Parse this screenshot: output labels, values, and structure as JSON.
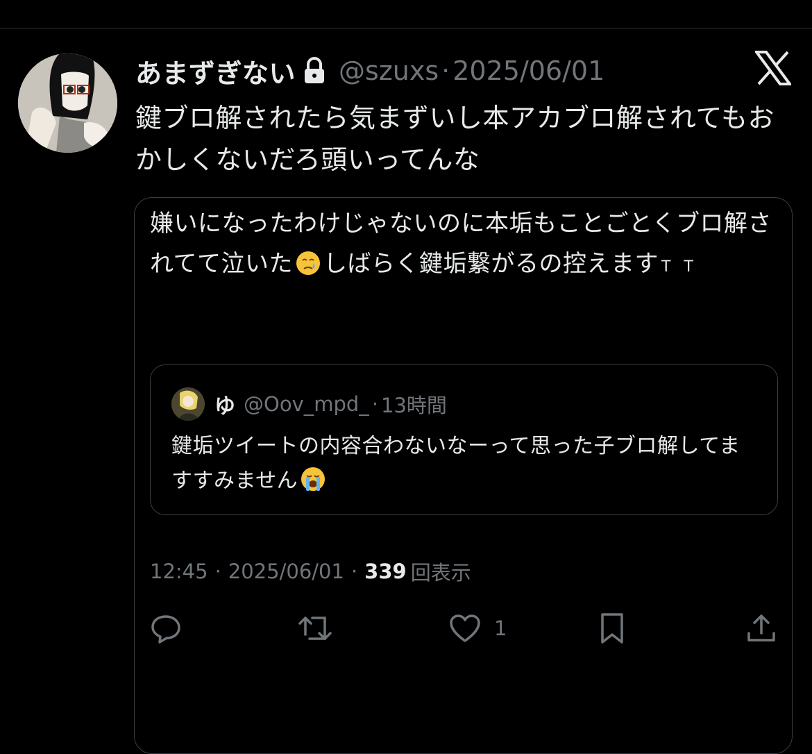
{
  "tweet": {
    "author_name": "あまずぎない",
    "author_handle": "@szuxs",
    "separator": "·",
    "date": "2025/06/01",
    "text": "鍵ブロ解されたら気まずいし本アカブロ解されてもおかしくないだろ頭いってんな"
  },
  "quote": {
    "text_part1": "嫌いになったわけじゃないのに本垢もことごとくブロ解されてて泣いた",
    "text_part2": "しばらく鍵垢繋がるの控えます",
    "text_suffix": "T T",
    "emoji_1": "crying-face",
    "nested": {
      "author_name": "ゆ",
      "author_handle": "@Oov_mpd_",
      "separator": "·",
      "time": "13時間",
      "text": "鍵垢ツイートの内容合わないなーって思った子ブロ解してますすみません",
      "emoji": "loudly-crying-face"
    },
    "meta": {
      "time": "12:45",
      "separator": "·",
      "date": "2025/06/01",
      "views": "339",
      "views_label": "回表示"
    },
    "actions": {
      "reply_icon": "reply-icon",
      "retweet_icon": "retweet-icon",
      "like_icon": "heart-icon",
      "like_count": "1",
      "bookmark_icon": "bookmark-icon",
      "share_icon": "share-icon"
    }
  },
  "colors": {
    "background": "#000000",
    "text_primary": "#e7e9ea",
    "text_secondary": "#71767b",
    "border": "#3a3f44"
  }
}
